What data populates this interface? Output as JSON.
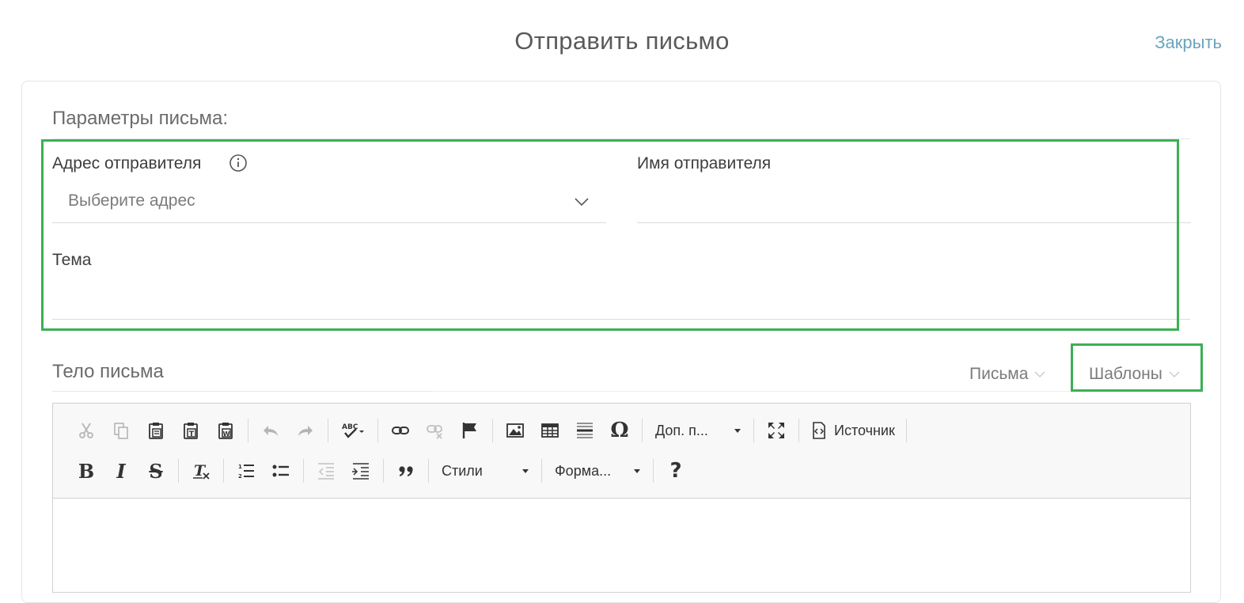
{
  "header": {
    "title": "Отправить письмо",
    "close_label": "Закрыть"
  },
  "params": {
    "title": "Параметры письма:",
    "sender_address_label": "Адрес отправителя",
    "sender_address_placeholder": "Выберите адрес",
    "sender_name_label": "Имя отправителя",
    "sender_name_value": "",
    "subject_label": "Тема",
    "subject_value": ""
  },
  "body": {
    "label": "Тело письма",
    "letters_dropdown": "Письма",
    "templates_dropdown": "Шаблоны"
  },
  "toolbar": {
    "row1_icons": [
      "cut-icon",
      "copy-icon",
      "paste-icon",
      "paste-text-icon",
      "paste-word-icon",
      "undo-icon",
      "redo-icon",
      "spellcheck-icon",
      "link-icon",
      "unlink-icon",
      "anchor-icon",
      "image-icon",
      "table-icon",
      "horizontal-line-icon",
      "special-char-icon",
      "maximize-icon",
      "source-icon"
    ],
    "extra_combo": "Доп. п...",
    "source_label": "Источник",
    "styles_combo": "Стили",
    "format_combo": "Форма...",
    "help_glyph": "?",
    "bold_glyph": "B",
    "italic_glyph": "I",
    "strike_glyph": "S"
  },
  "colors": {
    "accent": "#3cb054",
    "link": "#6aa4bd"
  }
}
